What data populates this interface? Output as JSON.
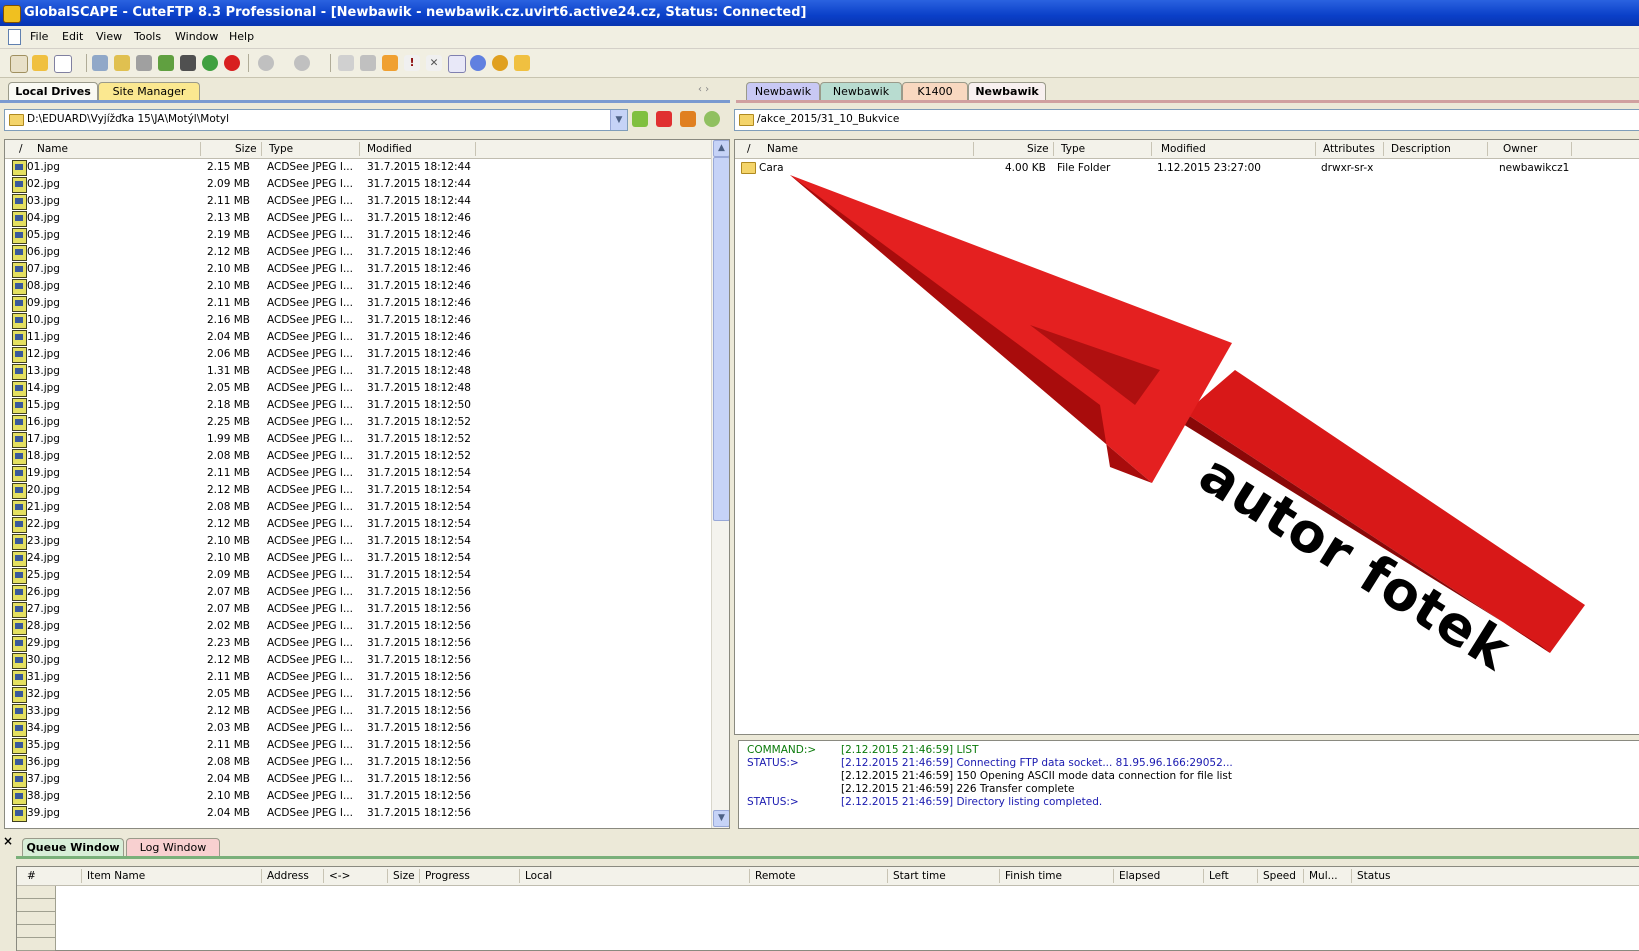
{
  "window": {
    "title": "GlobalSCAPE - CuteFTP 8.3 Professional - [Newbawik - newbawik.cz.uvirt6.active24.cz, Status: Connected]"
  },
  "menu": [
    "File",
    "Edit",
    "View",
    "Tools",
    "Window",
    "Help"
  ],
  "left_tabs": [
    "Local Drives",
    "Site Manager"
  ],
  "right_tabs": [
    "Newbawik",
    "Newbawik",
    "K1400",
    "Newbawik"
  ],
  "local": {
    "path": "D:\\EDUARD\\Vyjížďka 15\\JA\\Motýl\\Motyl",
    "columns": [
      "/",
      "Name",
      "Size",
      "Type",
      "Modified"
    ],
    "files": [
      {
        "name": "01.jpg",
        "size": "2.15 MB",
        "type": "ACDSee JPEG I...",
        "modified": "31.7.2015 18:12:44"
      },
      {
        "name": "02.jpg",
        "size": "2.09 MB",
        "type": "ACDSee JPEG I...",
        "modified": "31.7.2015 18:12:44"
      },
      {
        "name": "03.jpg",
        "size": "2.11 MB",
        "type": "ACDSee JPEG I...",
        "modified": "31.7.2015 18:12:44"
      },
      {
        "name": "04.jpg",
        "size": "2.13 MB",
        "type": "ACDSee JPEG I...",
        "modified": "31.7.2015 18:12:46"
      },
      {
        "name": "05.jpg",
        "size": "2.19 MB",
        "type": "ACDSee JPEG I...",
        "modified": "31.7.2015 18:12:46"
      },
      {
        "name": "06.jpg",
        "size": "2.12 MB",
        "type": "ACDSee JPEG I...",
        "modified": "31.7.2015 18:12:46"
      },
      {
        "name": "07.jpg",
        "size": "2.10 MB",
        "type": "ACDSee JPEG I...",
        "modified": "31.7.2015 18:12:46"
      },
      {
        "name": "08.jpg",
        "size": "2.10 MB",
        "type": "ACDSee JPEG I...",
        "modified": "31.7.2015 18:12:46"
      },
      {
        "name": "09.jpg",
        "size": "2.11 MB",
        "type": "ACDSee JPEG I...",
        "modified": "31.7.2015 18:12:46"
      },
      {
        "name": "10.jpg",
        "size": "2.16 MB",
        "type": "ACDSee JPEG I...",
        "modified": "31.7.2015 18:12:46"
      },
      {
        "name": "11.jpg",
        "size": "2.04 MB",
        "type": "ACDSee JPEG I...",
        "modified": "31.7.2015 18:12:46"
      },
      {
        "name": "12.jpg",
        "size": "2.06 MB",
        "type": "ACDSee JPEG I...",
        "modified": "31.7.2015 18:12:46"
      },
      {
        "name": "13.jpg",
        "size": "1.31 MB",
        "type": "ACDSee JPEG I...",
        "modified": "31.7.2015 18:12:48"
      },
      {
        "name": "14.jpg",
        "size": "2.05 MB",
        "type": "ACDSee JPEG I...",
        "modified": "31.7.2015 18:12:48"
      },
      {
        "name": "15.jpg",
        "size": "2.18 MB",
        "type": "ACDSee JPEG I...",
        "modified": "31.7.2015 18:12:50"
      },
      {
        "name": "16.jpg",
        "size": "2.25 MB",
        "type": "ACDSee JPEG I...",
        "modified": "31.7.2015 18:12:52"
      },
      {
        "name": "17.jpg",
        "size": "1.99 MB",
        "type": "ACDSee JPEG I...",
        "modified": "31.7.2015 18:12:52"
      },
      {
        "name": "18.jpg",
        "size": "2.08 MB",
        "type": "ACDSee JPEG I...",
        "modified": "31.7.2015 18:12:52"
      },
      {
        "name": "19.jpg",
        "size": "2.11 MB",
        "type": "ACDSee JPEG I...",
        "modified": "31.7.2015 18:12:54"
      },
      {
        "name": "20.jpg",
        "size": "2.12 MB",
        "type": "ACDSee JPEG I...",
        "modified": "31.7.2015 18:12:54"
      },
      {
        "name": "21.jpg",
        "size": "2.08 MB",
        "type": "ACDSee JPEG I...",
        "modified": "31.7.2015 18:12:54"
      },
      {
        "name": "22.jpg",
        "size": "2.12 MB",
        "type": "ACDSee JPEG I...",
        "modified": "31.7.2015 18:12:54"
      },
      {
        "name": "23.jpg",
        "size": "2.10 MB",
        "type": "ACDSee JPEG I...",
        "modified": "31.7.2015 18:12:54"
      },
      {
        "name": "24.jpg",
        "size": "2.10 MB",
        "type": "ACDSee JPEG I...",
        "modified": "31.7.2015 18:12:54"
      },
      {
        "name": "25.jpg",
        "size": "2.09 MB",
        "type": "ACDSee JPEG I...",
        "modified": "31.7.2015 18:12:54"
      },
      {
        "name": "26.jpg",
        "size": "2.07 MB",
        "type": "ACDSee JPEG I...",
        "modified": "31.7.2015 18:12:56"
      },
      {
        "name": "27.jpg",
        "size": "2.07 MB",
        "type": "ACDSee JPEG I...",
        "modified": "31.7.2015 18:12:56"
      },
      {
        "name": "28.jpg",
        "size": "2.02 MB",
        "type": "ACDSee JPEG I...",
        "modified": "31.7.2015 18:12:56"
      },
      {
        "name": "29.jpg",
        "size": "2.23 MB",
        "type": "ACDSee JPEG I...",
        "modified": "31.7.2015 18:12:56"
      },
      {
        "name": "30.jpg",
        "size": "2.12 MB",
        "type": "ACDSee JPEG I...",
        "modified": "31.7.2015 18:12:56"
      },
      {
        "name": "31.jpg",
        "size": "2.11 MB",
        "type": "ACDSee JPEG I...",
        "modified": "31.7.2015 18:12:56"
      },
      {
        "name": "32.jpg",
        "size": "2.05 MB",
        "type": "ACDSee JPEG I...",
        "modified": "31.7.2015 18:12:56"
      },
      {
        "name": "33.jpg",
        "size": "2.12 MB",
        "type": "ACDSee JPEG I...",
        "modified": "31.7.2015 18:12:56"
      },
      {
        "name": "34.jpg",
        "size": "2.03 MB",
        "type": "ACDSee JPEG I...",
        "modified": "31.7.2015 18:12:56"
      },
      {
        "name": "35.jpg",
        "size": "2.11 MB",
        "type": "ACDSee JPEG I...",
        "modified": "31.7.2015 18:12:56"
      },
      {
        "name": "36.jpg",
        "size": "2.08 MB",
        "type": "ACDSee JPEG I...",
        "modified": "31.7.2015 18:12:56"
      },
      {
        "name": "37.jpg",
        "size": "2.04 MB",
        "type": "ACDSee JPEG I...",
        "modified": "31.7.2015 18:12:56"
      },
      {
        "name": "38.jpg",
        "size": "2.10 MB",
        "type": "ACDSee JPEG I...",
        "modified": "31.7.2015 18:12:56"
      },
      {
        "name": "39.jpg",
        "size": "2.04 MB",
        "type": "ACDSee JPEG I...",
        "modified": "31.7.2015 18:12:56"
      }
    ]
  },
  "remote": {
    "path": "/akce_2015/31_10_Bukvice",
    "columns": [
      "/",
      "Name",
      "Size",
      "Type",
      "Modified",
      "Attributes",
      "Description",
      "Owner"
    ],
    "files": [
      {
        "name": "Cara",
        "size": "4.00 KB",
        "type": "File Folder",
        "modified": "1.12.2015 23:27:00",
        "attributes": "drwxr-sr-x",
        "description": "",
        "owner": "newbawikcz1"
      }
    ]
  },
  "log": [
    {
      "label": "COMMAND:>",
      "text": "[2.12.2015 21:46:59] LIST",
      "color": "#0a7a0a"
    },
    {
      "label": "STATUS:>",
      "text": "[2.12.2015 21:46:59] Connecting FTP data socket... 81.95.96.166:29052...",
      "color": "#1a1ab0"
    },
    {
      "label": "",
      "text": "[2.12.2015 21:46:59] 150 Opening ASCII mode data connection for file list",
      "color": "#000000"
    },
    {
      "label": "",
      "text": "[2.12.2015 21:46:59] 226 Transfer complete",
      "color": "#000000"
    },
    {
      "label": "STATUS:>",
      "text": "[2.12.2015 21:46:59] Directory listing completed.",
      "color": "#1a1ab0"
    }
  ],
  "bottom_tabs": [
    "Queue Window",
    "Log Window"
  ],
  "queue": {
    "close_glyph": "×",
    "columns": [
      "#",
      "Item Name",
      "Address",
      "<->",
      "Size",
      "Progress",
      "Local",
      "Remote",
      "Start time",
      "Finish time",
      "Elapsed",
      "Left",
      "Speed",
      "Mul...",
      "Status"
    ]
  },
  "annotation": {
    "text": "autor fotek",
    "arrow_color": "#e01010"
  }
}
